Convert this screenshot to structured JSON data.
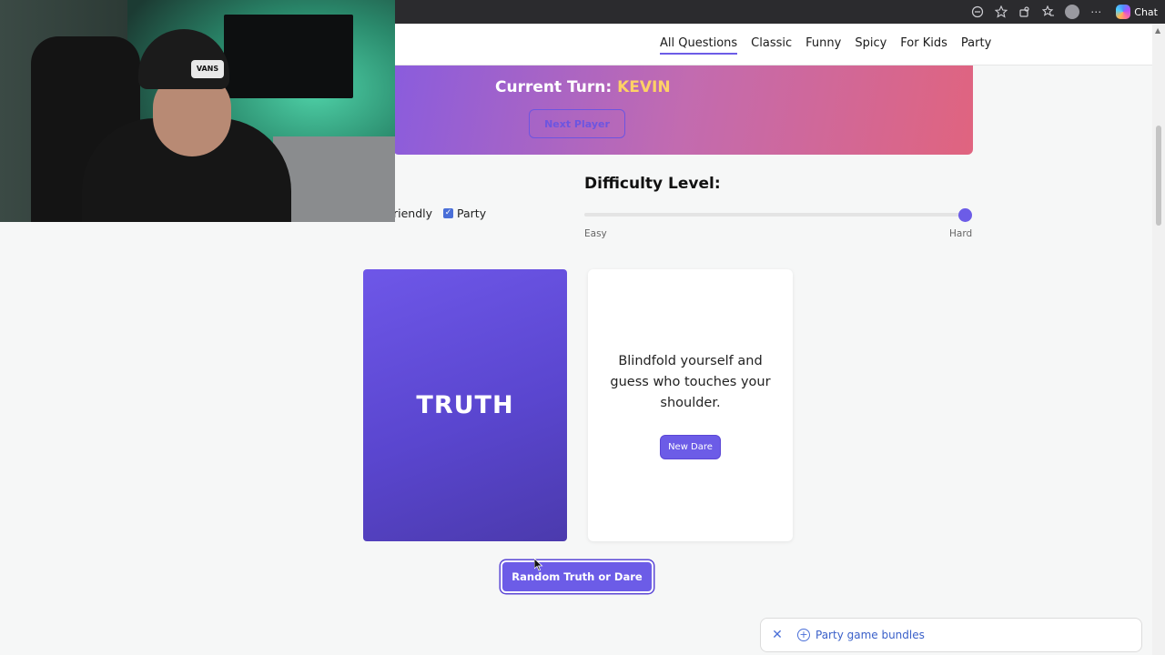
{
  "browser": {
    "icons": [
      "reader-mode-icon",
      "favorite-star-icon",
      "extensions-icon",
      "favorites-icon",
      "profile-icon",
      "more-icon"
    ],
    "chat_label": "Chat"
  },
  "nav": {
    "items": [
      {
        "label": "All Questions",
        "active": true
      },
      {
        "label": "Classic",
        "active": false
      },
      {
        "label": "Funny",
        "active": false
      },
      {
        "label": "Spicy",
        "active": false
      },
      {
        "label": "For Kids",
        "active": false
      },
      {
        "label": "Party",
        "active": false
      }
    ]
  },
  "turn": {
    "prefix": "Current Turn:",
    "player": "KEVIN",
    "next_button": "Next Player"
  },
  "filters": {
    "items": [
      {
        "label": "riendly",
        "checked": true
      },
      {
        "label": "Party",
        "checked": true
      }
    ]
  },
  "difficulty": {
    "title": "Difficulty Level:",
    "min_label": "Easy",
    "max_label": "Hard",
    "value_fraction": 1.0
  },
  "truth_card": {
    "label": "TRUTH"
  },
  "dare_card": {
    "text": "Blindfold yourself and guess who touches your shoulder.",
    "button": "New Dare"
  },
  "random_button": "Random Truth or Dare",
  "bundle_bar": {
    "label": "Party game bundles"
  },
  "webcam": {
    "patch_text": "VANS"
  },
  "colors": {
    "accent": "#6c5ce7",
    "banner_start": "#8a5cdd",
    "banner_end": "#e0647f",
    "player_highlight": "#ffd166",
    "link_blue": "#3a60c9"
  }
}
